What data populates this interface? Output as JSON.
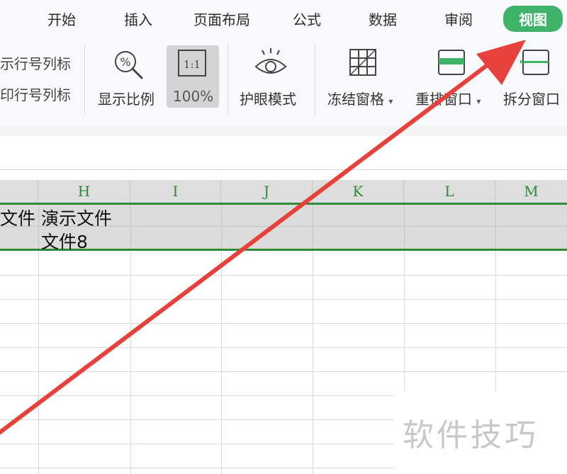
{
  "tabs": [
    {
      "label": "开始"
    },
    {
      "label": "插入"
    },
    {
      "label": "页面布局"
    },
    {
      "label": "公式"
    },
    {
      "label": "数据"
    },
    {
      "label": "审阅"
    },
    {
      "label": "视图"
    }
  ],
  "ribbon": {
    "left_top_label": "示行号列标",
    "left_bottom_label": "印行号列标",
    "zoom_label": "显示比例",
    "zoom_icon_text": "%",
    "hundred_icon_text": "1:1",
    "hundred_label": "100%",
    "eye_label": "护眼模式",
    "freeze_label": "冻结窗格",
    "rearrange_label": "重排窗口",
    "split_label": "拆分窗口"
  },
  "sheet": {
    "columns": [
      "H",
      "I",
      "J",
      "K",
      "L",
      "M"
    ],
    "cells": {
      "g_partial": "文件",
      "h_line1": "演示文件",
      "h_line2": "文件8"
    }
  },
  "watermark": "软件技巧",
  "colors": {
    "active_tab": "#3fb36a",
    "selection_border": "#2e8b3a",
    "arrow": "#e8403a"
  }
}
